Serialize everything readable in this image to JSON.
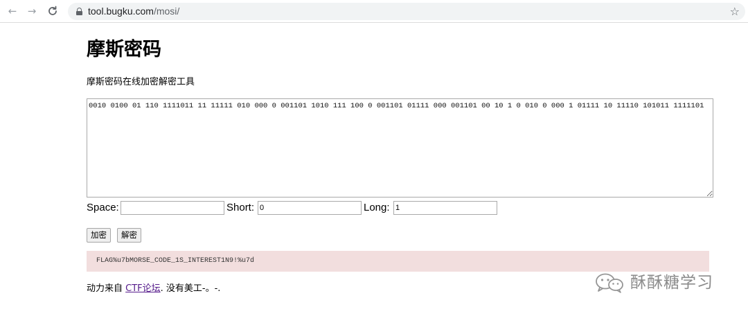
{
  "browser": {
    "back_icon": "←",
    "forward_icon": "→",
    "reload_icon": "C",
    "url_host": "tool.bugku.com",
    "url_path": "/mosi/",
    "star_icon": "☆"
  },
  "page": {
    "title": "摩斯密码",
    "subtitle": "摩斯密码在线加密解密工具",
    "input_text": "0010 0100 01 110 1111011 11 11111 010 000 0 001101 1010 111 100 0 001101 01111 000 001101 00 10 1 0 010 0 000 1 01111 10 11110 101011 1111101",
    "params": {
      "space_label": "Space:",
      "space_value": "",
      "short_label": "Short:",
      "short_value": "0",
      "long_label": "Long:",
      "long_value": "1"
    },
    "encrypt_button": "加密",
    "decrypt_button": "解密",
    "result": "FLAG%u7bMORSE_CODE_1S_INTEREST1N9!%u7d",
    "footer": {
      "prefix": "动力来自 ",
      "link": "CTF论坛",
      "suffix": ". 没有美工-。-."
    }
  },
  "watermark": {
    "text": "酥酥糖学习",
    "icon": "wechat-icon"
  }
}
